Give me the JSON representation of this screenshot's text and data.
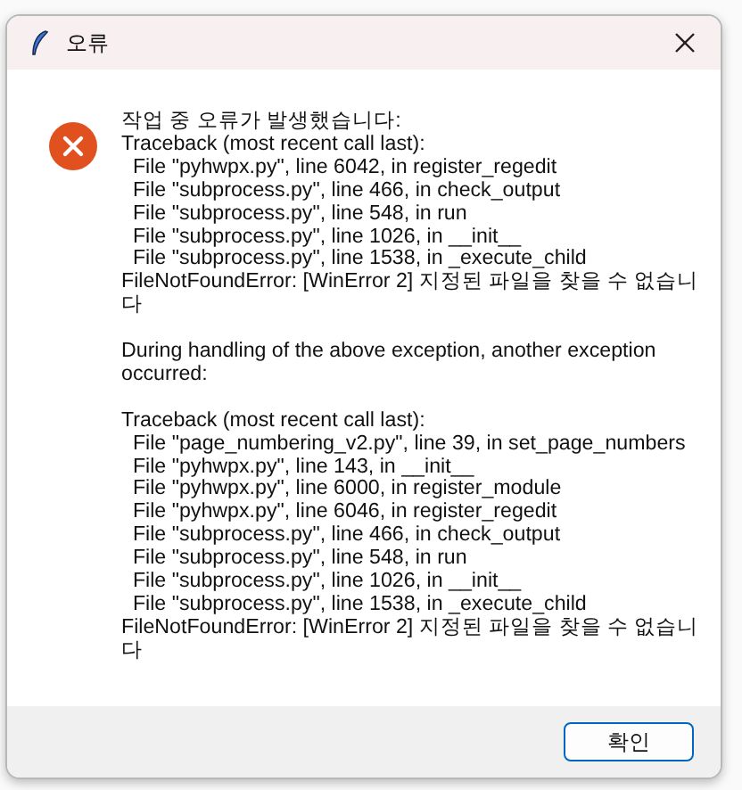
{
  "window": {
    "title": "오류"
  },
  "message": [
    [
      "작업 중 오류가 발생했습니다:",
      "Traceback (most recent call last):",
      "  File \"pyhwpx.py\", line 6042, in register_regedit",
      "  File \"subprocess.py\", line 466, in check_output",
      "  File \"subprocess.py\", line 548, in run",
      "  File \"subprocess.py\", line 1026, in __init__",
      "  File \"subprocess.py\", line 1538, in _execute_child",
      "FileNotFoundError: [WinError 2] 지정된 파일을 찾을 수 없습니",
      "다"
    ],
    [
      "During handling of the above exception, another exception",
      "occurred:"
    ],
    [
      "Traceback (most recent call last):",
      "  File \"page_numbering_v2.py\", line 39, in set_page_numbers",
      "  File \"pyhwpx.py\", line 143, in __init__",
      "  File \"pyhwpx.py\", line 6000, in register_module",
      "  File \"pyhwpx.py\", line 6046, in register_regedit",
      "  File \"subprocess.py\", line 466, in check_output",
      "  File \"subprocess.py\", line 548, in run",
      "  File \"subprocess.py\", line 1026, in __init__",
      "  File \"subprocess.py\", line 1538, in _execute_child",
      "FileNotFoundError: [WinError 2] 지정된 파일을 찾을 수 없습니",
      "다"
    ]
  ],
  "buttons": [
    "확인"
  ]
}
